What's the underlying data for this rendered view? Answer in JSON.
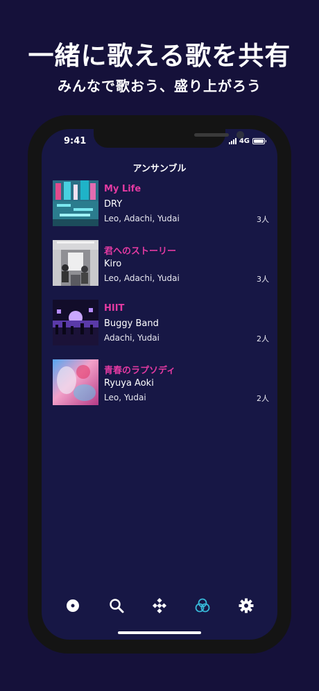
{
  "promo": {
    "headline": "一緒に歌える歌を共有",
    "subhead": "みんなで歌おう、盛り上がろう"
  },
  "status_bar": {
    "time": "9:41",
    "network": "4G"
  },
  "nav": {
    "title": "アンサンブル"
  },
  "songs": [
    {
      "title": "My Life",
      "artist": "DRY",
      "members": "Leo, Adachi, Yudai",
      "count": "3人"
    },
    {
      "title": "君へのストーリー",
      "artist": "Kiro",
      "members": "Leo, Adachi, Yudai",
      "count": "3人"
    },
    {
      "title": "HIIT",
      "artist": "Buggy Band",
      "members": "Adachi, Yudai",
      "count": "2人"
    },
    {
      "title": "青春のラプソディ",
      "artist": "Ryuya Aoki",
      "members": "Leo, Yudai",
      "count": "2人"
    }
  ],
  "tabs": [
    {
      "icon": "disc-icon",
      "active": false
    },
    {
      "icon": "search-icon",
      "active": false
    },
    {
      "icon": "diamond-grid-icon",
      "active": false
    },
    {
      "icon": "ensemble-icon",
      "active": true
    },
    {
      "icon": "gear-icon",
      "active": false
    }
  ],
  "colors": {
    "background": "#15113a",
    "screen": "#171745",
    "accent_title": "#e43aa2",
    "active_tab": "#37b8d8"
  }
}
